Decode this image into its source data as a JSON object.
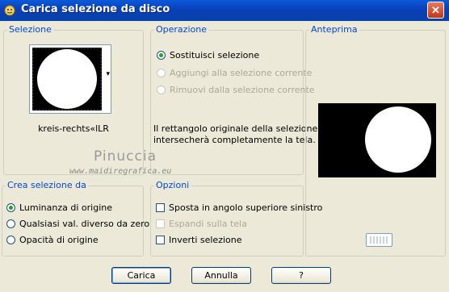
{
  "window": {
    "title": "Carica selezione da disco",
    "close_glyph": "✕"
  },
  "selezione": {
    "legend": "Selezione",
    "file_name": "kreis-rechts«lLR",
    "dropdown_glyph": "▾"
  },
  "operazione": {
    "legend": "Operazione",
    "options": [
      {
        "label": "Sostituisci selezione",
        "selected": true,
        "enabled": true
      },
      {
        "label": "Aggiungi alla selezione corrente",
        "selected": false,
        "enabled": false
      },
      {
        "label": "Rimuovi dalla selezione corrente",
        "selected": false,
        "enabled": false
      }
    ],
    "description_line1": "Il rettangolo originale della selezione",
    "description_line2": "intersecherà completamente la tela."
  },
  "anteprima": {
    "legend": "Anteprima"
  },
  "watermark": {
    "name": "Pinuccia",
    "url": "www.maidiregrafica.eu"
  },
  "crea_selezione": {
    "legend": "Crea selezione da",
    "options": [
      {
        "label": "Luminanza di origine",
        "selected": true
      },
      {
        "label": "Qualsiasi val. diverso da zero",
        "selected": false
      },
      {
        "label": "Opacità di origine",
        "selected": false
      }
    ]
  },
  "opzioni": {
    "legend": "Opzioni",
    "options": [
      {
        "label": "Sposta in angolo superiore sinistro",
        "checked": false,
        "enabled": true
      },
      {
        "label": "Espandi sulla tela",
        "checked": false,
        "enabled": false
      },
      {
        "label": "Inverti selezione",
        "checked": false,
        "enabled": true
      }
    ]
  },
  "buttons": {
    "ok": "Carica",
    "cancel": "Annulla",
    "help": "?"
  },
  "colors": {
    "title_bar": "#0a4fc8",
    "legend_text": "#0046d5",
    "radio_dot": "#21a121",
    "face": "#ece9d8"
  }
}
